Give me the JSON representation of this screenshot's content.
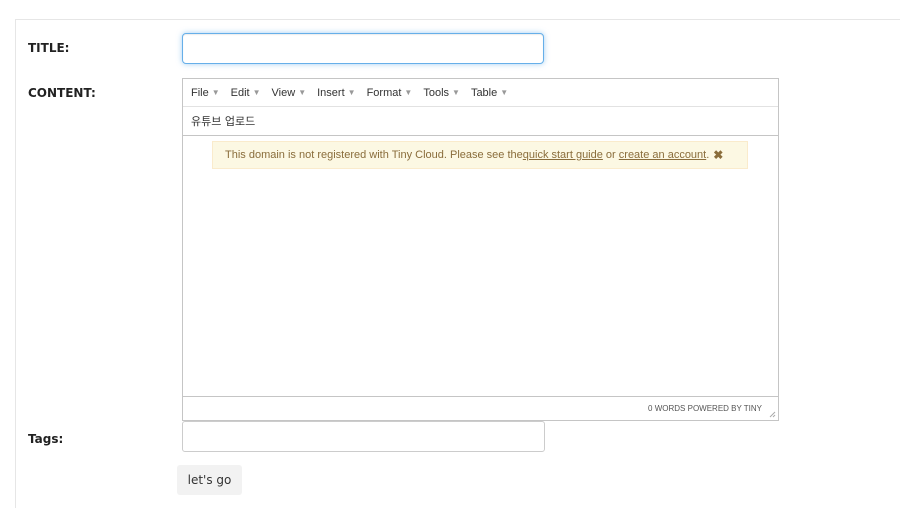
{
  "form": {
    "title_label": "TITLE:",
    "title_value": "",
    "content_label": "CONTENT:",
    "tags_label": "Tags:",
    "tags_value": "",
    "submit_label": "let's go"
  },
  "editor": {
    "menu": [
      {
        "label": "File"
      },
      {
        "label": "Edit"
      },
      {
        "label": "View"
      },
      {
        "label": "Insert"
      },
      {
        "label": "Format"
      },
      {
        "label": "Tools"
      },
      {
        "label": "Table"
      }
    ],
    "menu_caret_icon": "caret-down-icon",
    "toolbar_button": "유튜브 업로드",
    "notice": {
      "text_before": "This domain is not registered with Tiny Cloud. Please see the ",
      "link1": "quick start guide",
      "text_middle": " or ",
      "link2": "create an account",
      "text_after": ".",
      "close_icon": "close-icon"
    },
    "status": "0 WORDS POWERED BY TINY",
    "resize_icon": "resize-handle-icon"
  },
  "colors": {
    "focus_border": "#66afe9",
    "notice_background": "#fcf8e3",
    "notice_text": "#8a6d3b",
    "editor_border": "#c5c5c5"
  }
}
